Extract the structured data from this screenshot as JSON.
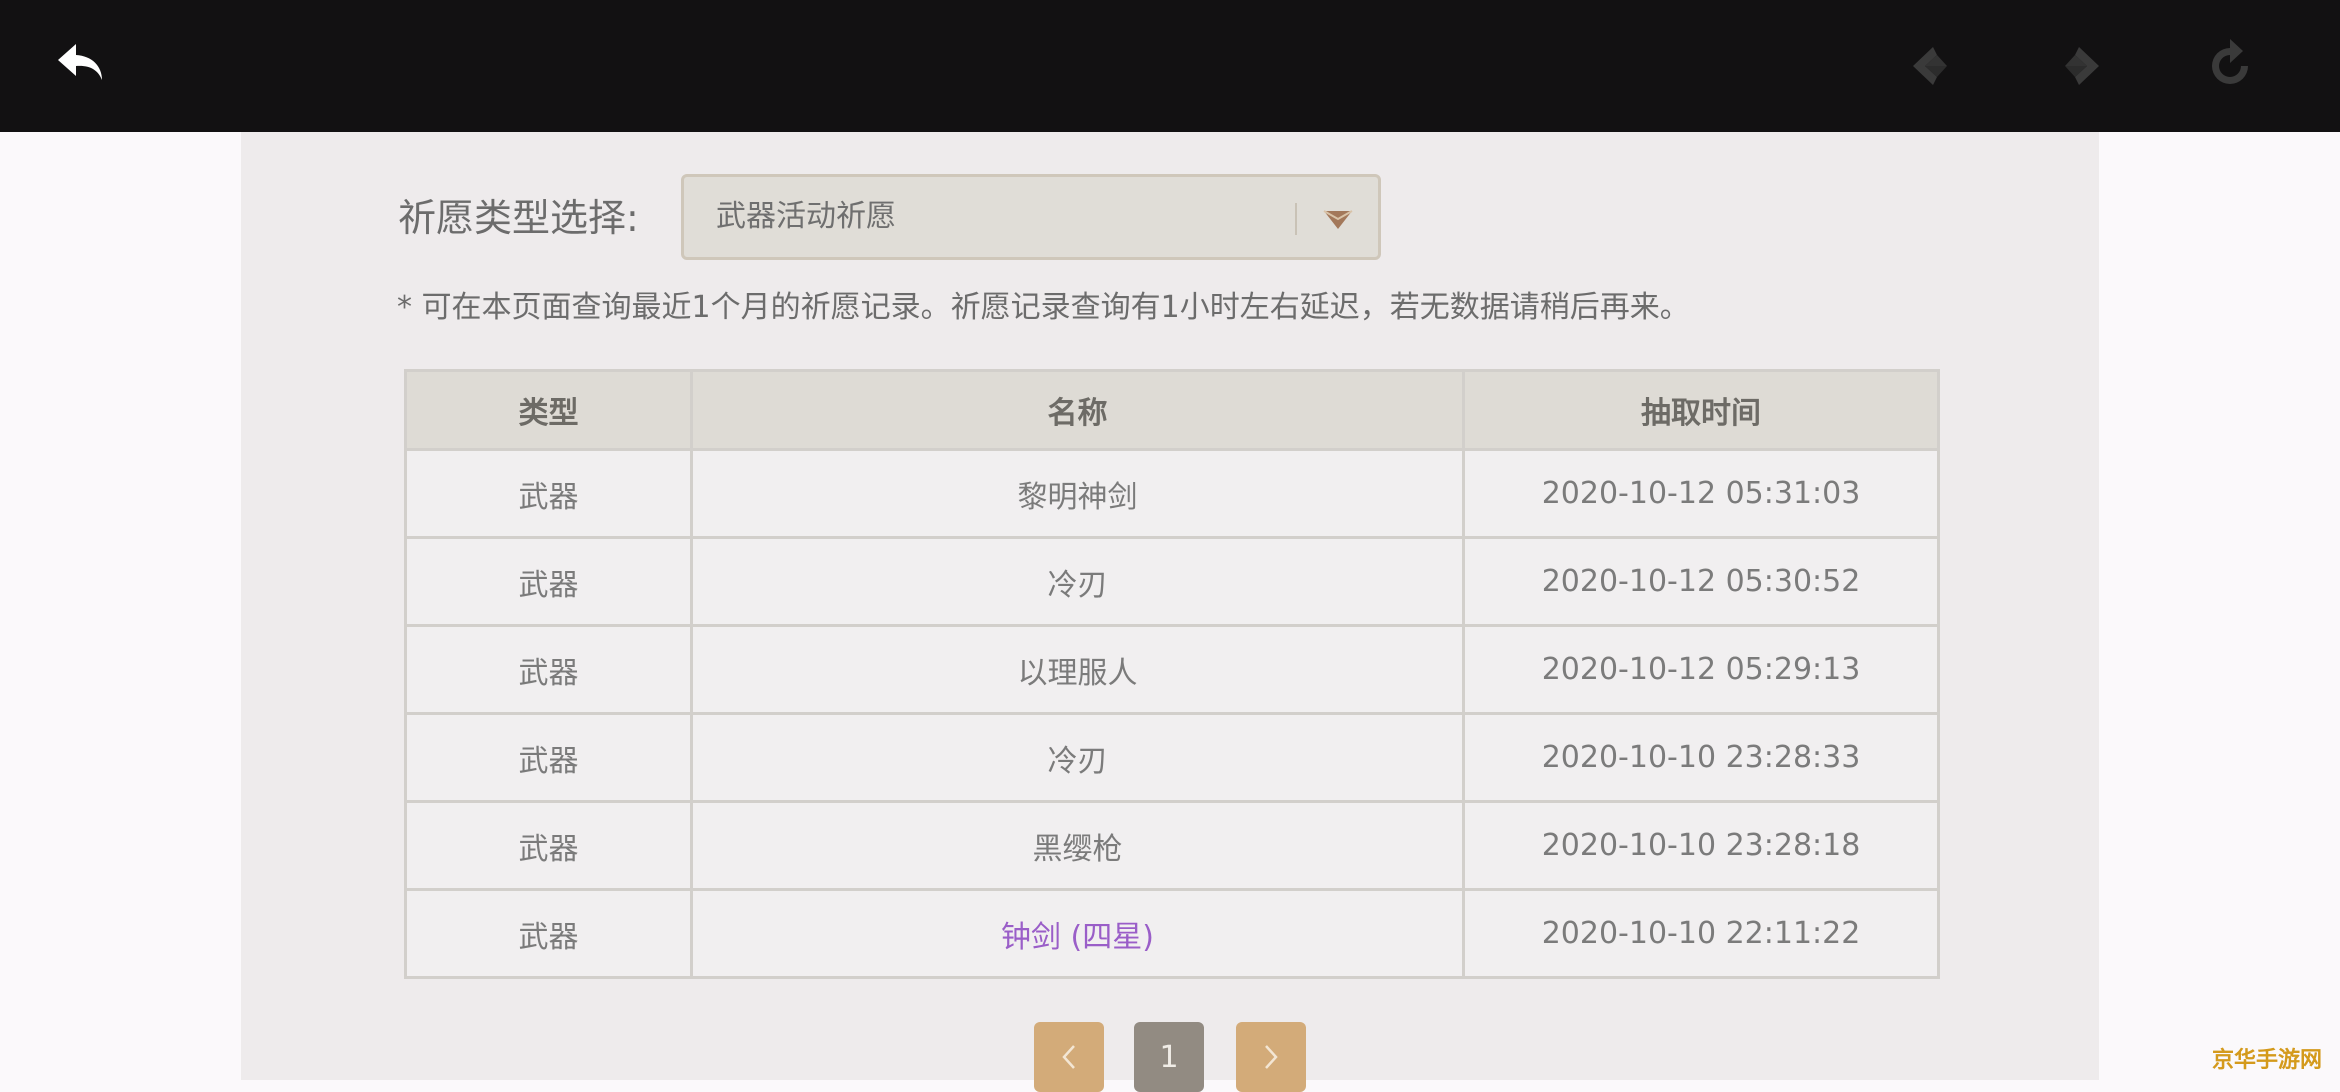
{
  "topbar": {
    "back_icon": "back-arrow-icon",
    "prev_icon": "nav-back-icon",
    "next_icon": "nav-forward-icon",
    "refresh_icon": "refresh-icon"
  },
  "filter": {
    "label": "祈愿类型选择:",
    "selected": "武器活动祈愿"
  },
  "notice": "* 可在本页面查询最近1个月的祈愿记录。祈愿记录查询有1小时左右延迟，若无数据请稍后再来。",
  "table": {
    "headers": [
      "类型",
      "名称",
      "抽取时间"
    ],
    "rows": [
      {
        "type": "武器",
        "name": "黎明神剑",
        "time": "2020-10-12 05:31:03"
      },
      {
        "type": "武器",
        "name": "冷刃",
        "time": "2020-10-12 05:30:52"
      },
      {
        "type": "武器",
        "name": "以理服人",
        "time": "2020-10-12 05:29:13"
      },
      {
        "type": "武器",
        "name": "冷刃",
        "time": "2020-10-10 23:28:33"
      },
      {
        "type": "武器",
        "name": "黑缨枪",
        "time": "2020-10-10 23:28:18"
      },
      {
        "type": "武器",
        "name": "钟剑 (四星)",
        "time": "2020-10-10 22:11:22"
      }
    ]
  },
  "pagination": {
    "current_page": "1"
  },
  "watermark": "京华手游网",
  "colors": {
    "topbar": "#121112",
    "panel": "#eeebec",
    "accent": "#d3ab79",
    "rare_item": "#9a5ec8"
  }
}
